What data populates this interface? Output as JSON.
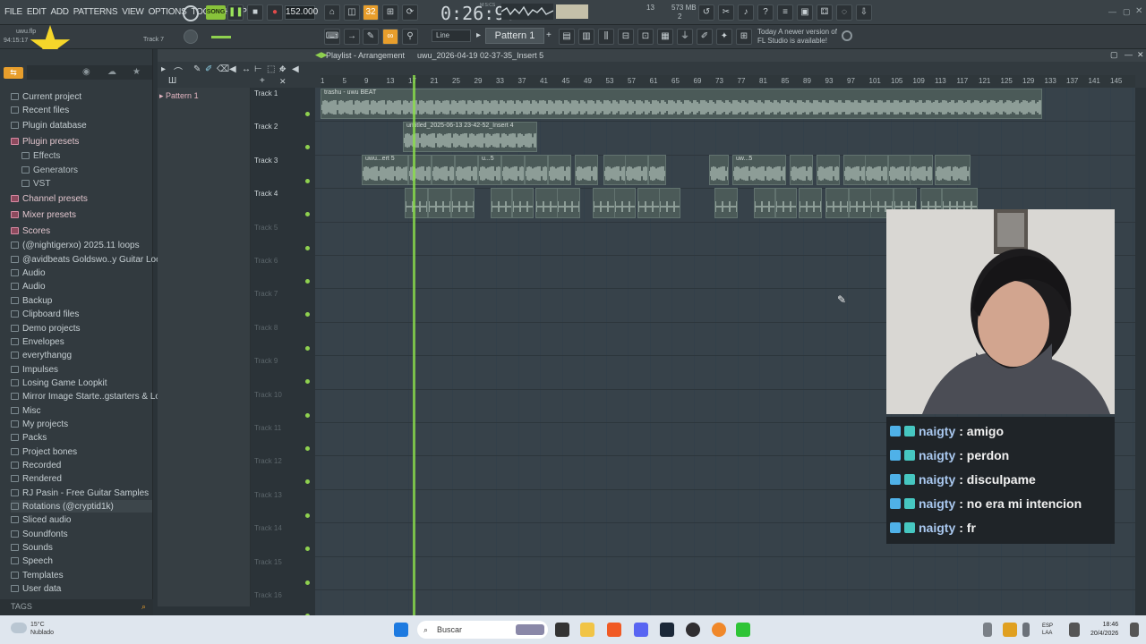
{
  "menu": [
    "FILE",
    "EDIT",
    "ADD",
    "PATTERNS",
    "VIEW",
    "OPTIONS",
    "TOOLS",
    "HELP"
  ],
  "transport": {
    "song_mode": "SONG",
    "tempo": "152.000",
    "time": "0:26:90",
    "time_unit": "M:S:CS"
  },
  "counters": {
    "a": "13",
    "mem": "573 MB",
    "b": "2"
  },
  "toolbar2": {
    "snap": "Line",
    "pattern": "Pattern 1"
  },
  "news": {
    "line1": "Today  A newer version of",
    "line2": "FL Studio is available!"
  },
  "top_left": {
    "file": "uwu.flp",
    "time": "94:15:17",
    "track": "Track 7"
  },
  "playlist": {
    "title": "Playlist - Arrangement",
    "arrangement": "uwu_2026-04-19 02-37-35_Insert 5"
  },
  "ruler": [
    "1",
    "5",
    "9",
    "13",
    "17",
    "21",
    "25",
    "29",
    "33",
    "37",
    "41",
    "45",
    "49",
    "53",
    "57",
    "61",
    "65",
    "69",
    "73",
    "77",
    "81",
    "85",
    "89",
    "93",
    "97",
    "101",
    "105",
    "109",
    "113",
    "117",
    "121",
    "125",
    "129",
    "133",
    "137",
    "141",
    "145"
  ],
  "patterns": [
    "Pattern 1"
  ],
  "tracks": [
    "Track 1",
    "Track 2",
    "Track 3",
    "Track 4",
    "Track 5",
    "Track 6",
    "Track 7",
    "Track 8",
    "Track 9",
    "Track 10",
    "Track 11",
    "Track 12",
    "Track 13",
    "Track 14",
    "Track 15",
    "Track 16"
  ],
  "clips": {
    "track1": "trashu - uwu BEAT",
    "track2": "untitled_2025-06-13 23-42-52_Insert 4",
    "track3a": "uwu...ert 5",
    "track3b": "u...5",
    "track3c": "uw...5"
  },
  "browser": [
    {
      "label": "Current project",
      "style": "normal"
    },
    {
      "label": "Recent files",
      "style": "normal"
    },
    {
      "label": "Plugin database",
      "style": "normal"
    },
    {
      "label": "Plugin presets",
      "style": "pink"
    },
    {
      "label": "Effects",
      "style": "sub"
    },
    {
      "label": "Generators",
      "style": "sub"
    },
    {
      "label": "VST",
      "style": "sub"
    },
    {
      "label": "Channel presets",
      "style": "pink"
    },
    {
      "label": "Mixer presets",
      "style": "pink"
    },
    {
      "label": "Scores",
      "style": "pink"
    },
    {
      "label": "(@nightigerxo) 2025.11 loops",
      "style": "normal"
    },
    {
      "label": "@avidbeats Goldswo..y Guitar Loop Kit",
      "style": "normal"
    },
    {
      "label": "Audio",
      "style": "normal"
    },
    {
      "label": "Audio",
      "style": "normal"
    },
    {
      "label": "Backup",
      "style": "normal"
    },
    {
      "label": "Clipboard files",
      "style": "normal"
    },
    {
      "label": "Demo projects",
      "style": "normal"
    },
    {
      "label": "Envelopes",
      "style": "normal"
    },
    {
      "label": "everythangg",
      "style": "normal"
    },
    {
      "label": "Impulses",
      "style": "normal"
    },
    {
      "label": "Losing Game Loopkit",
      "style": "normal"
    },
    {
      "label": "Mirror Image Starte..gstarters & Loops)",
      "style": "normal"
    },
    {
      "label": "Misc",
      "style": "normal"
    },
    {
      "label": "My projects",
      "style": "normal"
    },
    {
      "label": "Packs",
      "style": "normal"
    },
    {
      "label": "Project bones",
      "style": "normal"
    },
    {
      "label": "Recorded",
      "style": "normal"
    },
    {
      "label": "Rendered",
      "style": "normal"
    },
    {
      "label": "RJ Pasin - Free Guitar Samples",
      "style": "normal"
    },
    {
      "label": "Rotations (@cryptid1k)",
      "style": "hl"
    },
    {
      "label": "Sliced audio",
      "style": "normal"
    },
    {
      "label": "Soundfonts",
      "style": "normal"
    },
    {
      "label": "Sounds",
      "style": "normal"
    },
    {
      "label": "Speech",
      "style": "normal"
    },
    {
      "label": "Templates",
      "style": "normal"
    },
    {
      "label": "User data",
      "style": "normal"
    }
  ],
  "tags_label": "TAGS",
  "chat": [
    {
      "user": "naigty",
      "msg": ": amigo"
    },
    {
      "user": "naigty",
      "msg": ": perdon"
    },
    {
      "user": "naigty",
      "msg": ": disculpame"
    },
    {
      "user": "naigty",
      "msg": ": no era mi intencion"
    },
    {
      "user": "naigty",
      "msg": ": fr"
    }
  ],
  "taskbar": {
    "search_placeholder": "Buscar",
    "weather_temp": "15°C",
    "weather_desc": "Nublado",
    "lang1": "ESP",
    "lang2": "LAA",
    "time": "18:46",
    "date": "20/4/2026"
  },
  "colors": {
    "accent_green": "#8be04b",
    "pink": "#d88aa3",
    "clip": "#4b5a58",
    "song_btn": "#88c33a"
  }
}
